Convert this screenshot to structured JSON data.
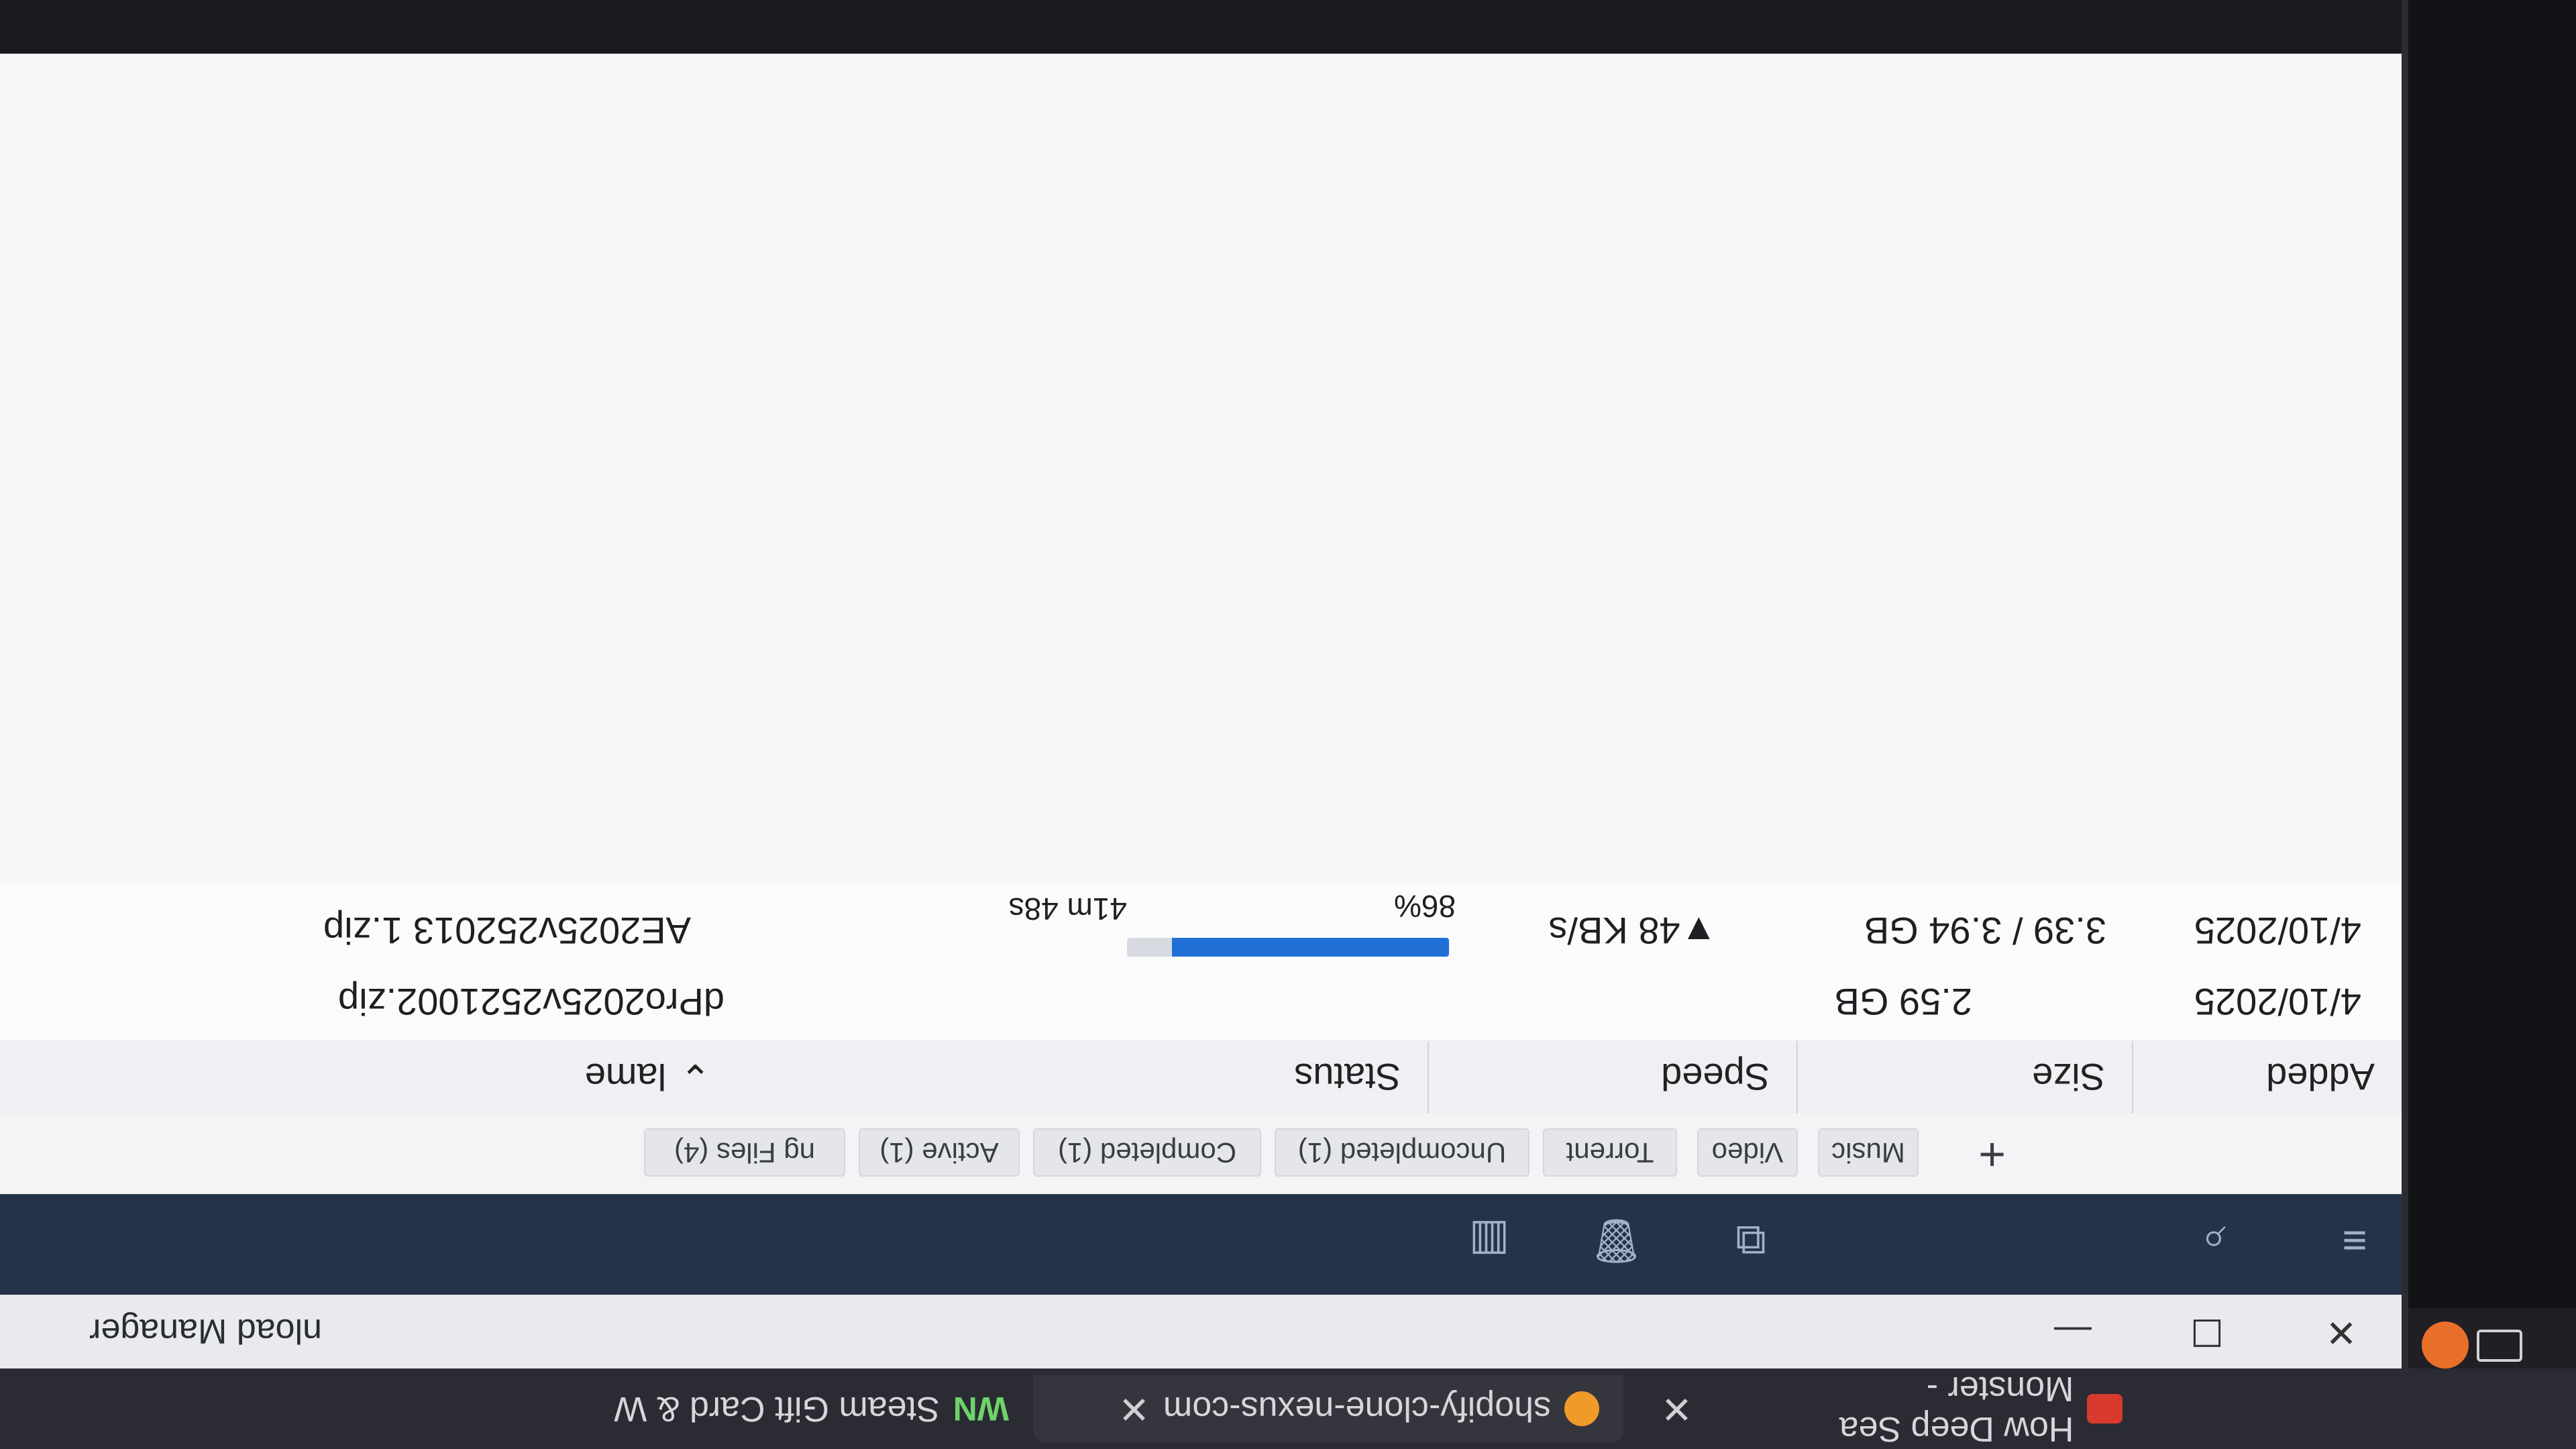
{
  "browser_tabs": [
    {
      "label": "How Deep Sea Monster -"
    },
    {
      "label": "shopify-clone-nexus-com"
    },
    {
      "label": "Steam Gift Card & W"
    }
  ],
  "window": {
    "title": "nload Manager"
  },
  "filters": [
    "ng Files (4)",
    "Active (1)",
    "Completed (1)",
    "Uncompleted (1)",
    "Torrent",
    "Video",
    "Music"
  ],
  "columns": {
    "name": "lame",
    "status": "Status",
    "speed": "Speed",
    "size": "Size",
    "added": "Added"
  },
  "rows": [
    {
      "name": "dPro2025v2521002.zip",
      "size": "2.59 GB",
      "added": "4/10/2025"
    },
    {
      "name": "AE2025v252013 1.zip",
      "progress_label": "86%",
      "progress": 0.86,
      "eta": "41m 48s",
      "speed": "▼48 KB/s",
      "size": "3.39 / 3.94 GB",
      "added": "4/10/2025"
    }
  ],
  "accent_color": "#1f6fd6",
  "toolbar_color": "#243349"
}
